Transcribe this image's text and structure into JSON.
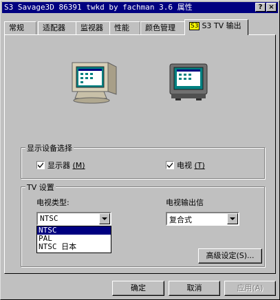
{
  "window": {
    "title": "S3 Savage3D 86391 twkd by fachman 3.6 属性",
    "help_glyph": "?",
    "close_glyph": "×"
  },
  "tabs": [
    {
      "label": "常规"
    },
    {
      "label": "适配器"
    },
    {
      "label": "监视器"
    },
    {
      "label": "性能"
    },
    {
      "label": "颜色管理"
    },
    {
      "badge": "S3",
      "label": "S3 TV 输出"
    }
  ],
  "display_select": {
    "legend": "显示设备选择",
    "monitor_label": "显示器",
    "monitor_key": "(M)",
    "monitor_checked": true,
    "tv_label": "电视",
    "tv_key": "(T)",
    "tv_checked": true
  },
  "tv_settings": {
    "legend": "TV 设置",
    "type_label": "电视类型:",
    "type_value": "NTSC",
    "type_options": [
      "NTSC",
      "PAL",
      "NTSC 日本"
    ],
    "output_label": "电视输出信",
    "output_value": "复合式",
    "advanced_button": "高级设定(S)..."
  },
  "footer": {
    "ok": "确定",
    "cancel": "取消",
    "apply": "应用(A)"
  },
  "colors": {
    "titlebar": "#000080",
    "face": "#c0c0c0",
    "selection": "#000080",
    "badge": "#ffff00"
  }
}
